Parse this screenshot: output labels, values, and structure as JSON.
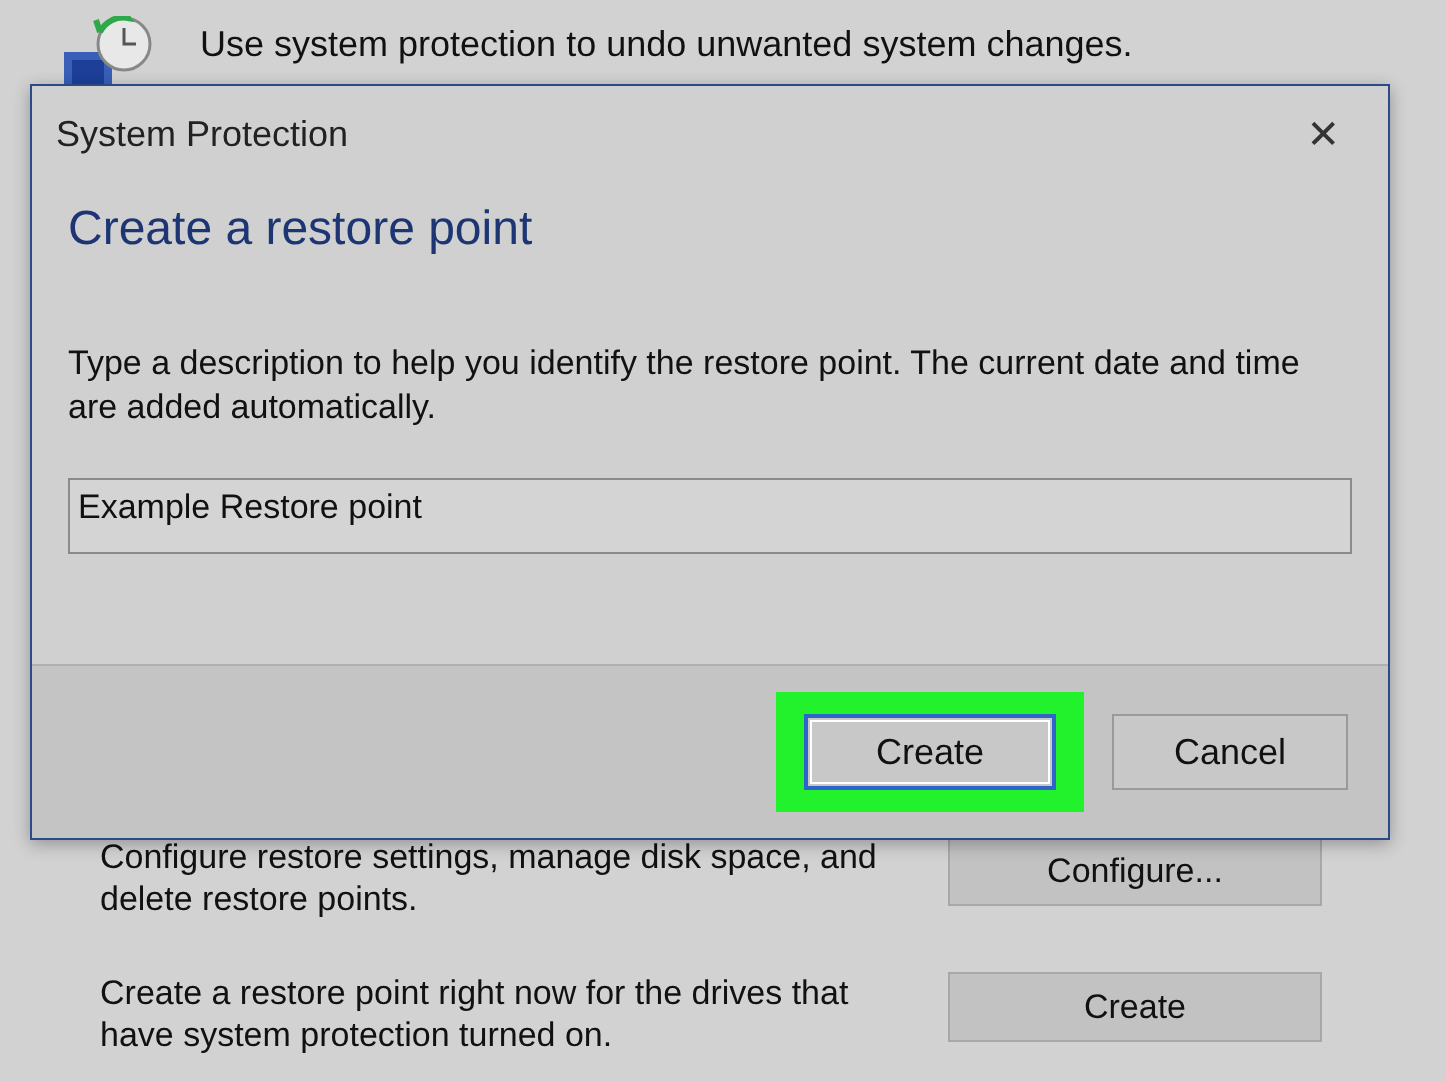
{
  "background": {
    "intro": "Use system protection to undo unwanted system changes.",
    "rows": [
      {
        "text": "Configure restore settings, manage disk space, and delete restore points.",
        "button": "Configure..."
      },
      {
        "text": "Create a restore point right now for the drives that have system protection turned on.",
        "button": "Create"
      }
    ]
  },
  "dialog": {
    "title": "System Protection",
    "close": "✕",
    "heading": "Create a restore point",
    "description": "Type a description to help you identify the restore point. The current date and time are added automatically.",
    "field": {
      "value": "Example Restore point"
    },
    "buttons": [
      {
        "label": "Create",
        "default": true,
        "highlighted": true
      },
      {
        "label": "Cancel",
        "default": false,
        "highlighted": false
      }
    ]
  }
}
